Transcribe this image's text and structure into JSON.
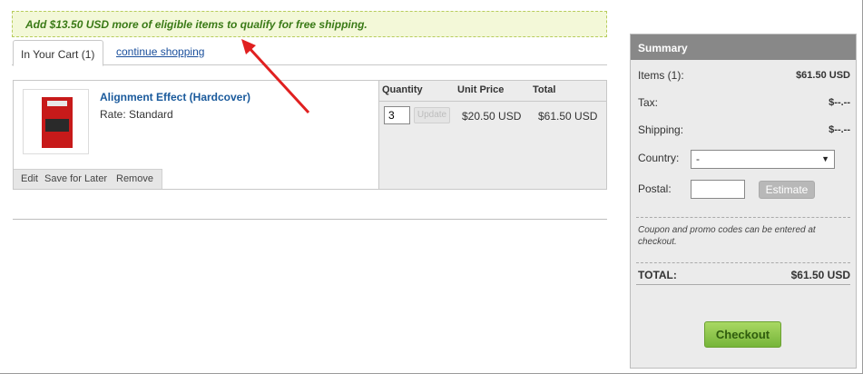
{
  "banner": {
    "text": "Add $13.50 USD more of eligible items to qualify for free shipping."
  },
  "tabs": {
    "active_label": "In Your Cart (1)",
    "continue_label": "continue shopping"
  },
  "item": {
    "title": "Alignment Effect (Hardcover)",
    "rate": "Rate: Standard",
    "actions": {
      "edit": "Edit",
      "save_for_later": "Save for Later",
      "remove": "Remove"
    },
    "columns": {
      "quantity": "Quantity",
      "unit_price": "Unit Price",
      "total": "Total"
    },
    "quantity": "3",
    "update_label": "Update",
    "unit_price": "$20.50 USD",
    "total": "$61.50 USD"
  },
  "summary": {
    "title": "Summary",
    "items_label": "Items (1):",
    "items_value": "$61.50 USD",
    "tax_label": "Tax:",
    "tax_value": "$--.--",
    "shipping_label": "Shipping:",
    "shipping_value": "$--.--",
    "country_label": "Country:",
    "country_selected": "-",
    "postal_label": "Postal:",
    "estimate_label": "Estimate",
    "coupon_note": "Coupon and promo codes can be entered at checkout.",
    "total_label": "TOTAL:",
    "total_value": "$61.50 USD",
    "checkout_label": "Checkout"
  },
  "colors": {
    "banner_text": "#3a7a16",
    "link": "#1a4f9c",
    "checkout": "#8cc84b",
    "arrow": "#e02020"
  }
}
